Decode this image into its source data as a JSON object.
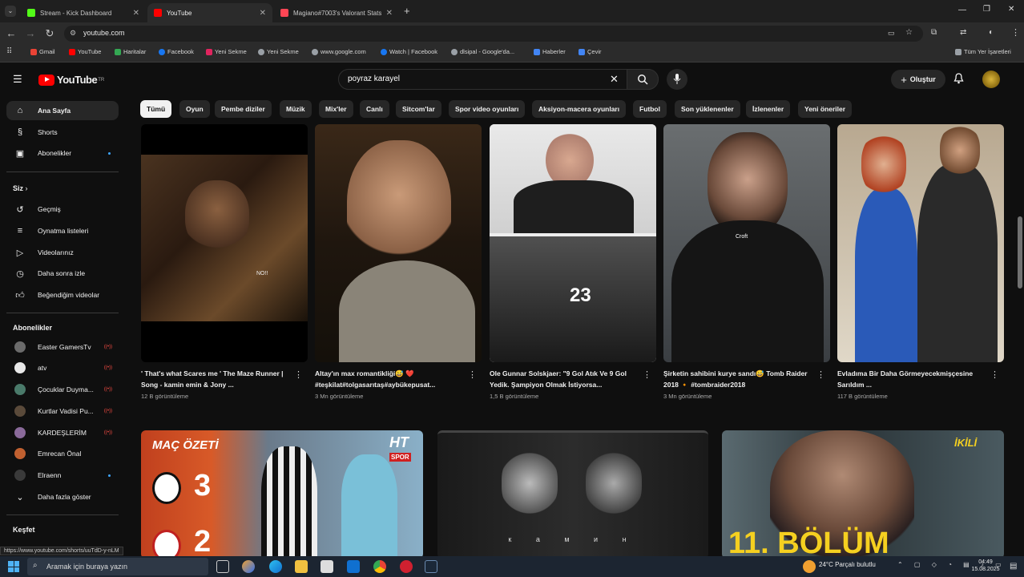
{
  "browser": {
    "tabs": [
      {
        "label": "Stream - Kick Dashboard",
        "active": false,
        "favicon_color": "#53fc18"
      },
      {
        "label": "YouTube",
        "active": true,
        "favicon_color": "#ff0000"
      },
      {
        "label": "Magiano#7003's Valorant Stats",
        "active": false,
        "favicon_color": "#ff4655"
      }
    ],
    "new_tab": "+",
    "url": "youtube.com",
    "bookmarks": [
      {
        "label": "Gmail",
        "icon": "gmail-icon",
        "color": "#ea4335"
      },
      {
        "label": "YouTube",
        "icon": "youtube-icon",
        "color": "#ff0000"
      },
      {
        "label": "Haritalar",
        "icon": "maps-icon",
        "color": "#34a853"
      },
      {
        "label": "Facebook",
        "icon": "facebook-icon",
        "color": "#1877f2"
      },
      {
        "label": "Yeni Sekme",
        "icon": "tab-icon",
        "color": "#e0245e"
      },
      {
        "label": "Yeni Sekme",
        "icon": "globe-icon",
        "color": "#9aa0a6"
      },
      {
        "label": "www.google.com",
        "icon": "globe-icon",
        "color": "#9aa0a6"
      },
      {
        "label": "Watch | Facebook",
        "icon": "facebook-icon",
        "color": "#1877f2"
      },
      {
        "label": "dlsipal - Google'da...",
        "icon": "globe-icon",
        "color": "#9aa0a6"
      },
      {
        "label": "Haberler",
        "icon": "news-icon",
        "color": "#4285f4"
      },
      {
        "label": "Çevir",
        "icon": "translate-icon",
        "color": "#4285f4"
      }
    ],
    "all_bookmarks": "Tüm Yer İşaretleri"
  },
  "header": {
    "logo": "YouTube",
    "logo_region": "TR",
    "search_value": "poyraz karayel",
    "create_label": "Oluştur"
  },
  "chips": [
    "Tümü",
    "Oyun",
    "Pembe diziler",
    "Müzik",
    "Mix'ler",
    "Canlı",
    "Sitcom'lar",
    "Spor video oyunları",
    "Aksiyon-macera oyunları",
    "Futbol",
    "Son yüklenenler",
    "İzlenenler",
    "Yeni öneriler"
  ],
  "sidebar": {
    "main": [
      {
        "label": "Ana Sayfa",
        "icon": "home-icon",
        "active": true
      },
      {
        "label": "Shorts",
        "icon": "shorts-icon"
      },
      {
        "label": "Abonelikler",
        "icon": "subscriptions-icon",
        "dot": true
      }
    ],
    "you_header": "Siz",
    "you": [
      {
        "label": "Geçmiş",
        "icon": "history-icon"
      },
      {
        "label": "Oynatma listeleri",
        "icon": "playlists-icon"
      },
      {
        "label": "Videolarınız",
        "icon": "your-videos-icon"
      },
      {
        "label": "Daha sonra izle",
        "icon": "watch-later-icon"
      },
      {
        "label": "Beğendiğim videolar",
        "icon": "liked-icon"
      }
    ],
    "subs_header": "Abonelikler",
    "subs": [
      {
        "label": "Easter GamersTv",
        "color": "#6b6b6b",
        "live": true
      },
      {
        "label": "atv",
        "color": "#e8e8e8",
        "live": true
      },
      {
        "label": "Çocuklar Duyma...",
        "color": "#4a7a6a",
        "live": true
      },
      {
        "label": "Kurtlar Vadisi Pu...",
        "color": "#5a4a3a",
        "live": true
      },
      {
        "label": "KARDEŞLERİM",
        "color": "#8a6a9a",
        "live": true
      },
      {
        "label": "Emrecan Önal",
        "color": "#c06030",
        "dot": true
      },
      {
        "label": "Elraenn",
        "color": "#3a3a3a",
        "dot": true
      }
    ],
    "show_more": "Daha fazla göster",
    "explore_header": "Keşfet"
  },
  "shorts": [
    {
      "title": "' That's what Scares me ' The Maze Runner | Song - kamin emin & Jony ...",
      "views": "12 B görüntüleme"
    },
    {
      "title": "Altay'ın max romantikliği😅 ❤️ #teşkilat#tolgasarıtaş#aybükepusat...",
      "views": "3 Mn görüntüleme"
    },
    {
      "title": "Ole Gunnar Solskjaer: \"9 Gol Atık Ve 9 Gol Yedik. Şampiyon Olmak İstiyorsa...",
      "views": "1,5 B görüntüleme"
    },
    {
      "title": "Şirketin sahibini kurye sandı😅 Tomb Raider 2018 🔸 #tombraider2018",
      "views": "3 Mn görüntüleme"
    },
    {
      "title": "Evladıma Bir Daha Görmeyecekmişçesine Sarıldım ...",
      "views": "117 B görüntüleme"
    }
  ],
  "thumb_text": {
    "t1_overlay": "NO!!",
    "t4_overlay": "Croft",
    "t3_number": "23",
    "b1_label": "MAÇ ÖZETİ",
    "b1_brand": "HT",
    "b1_brand2": "SPOR",
    "b1_score_home": "3",
    "b1_score_away": "2",
    "b2_text": "к а м и н",
    "b3_logo": "İKİLİ",
    "b3_episode": "11. BÖLÜM"
  },
  "status_url": "https://www.youtube.com/shorts/uuTdD-y-nLM",
  "taskbar": {
    "search_placeholder": "Aramak için buraya yazın",
    "weather": "24°C  Parçalı bulutlu",
    "time": "04:49",
    "date": "15.08.2025"
  }
}
